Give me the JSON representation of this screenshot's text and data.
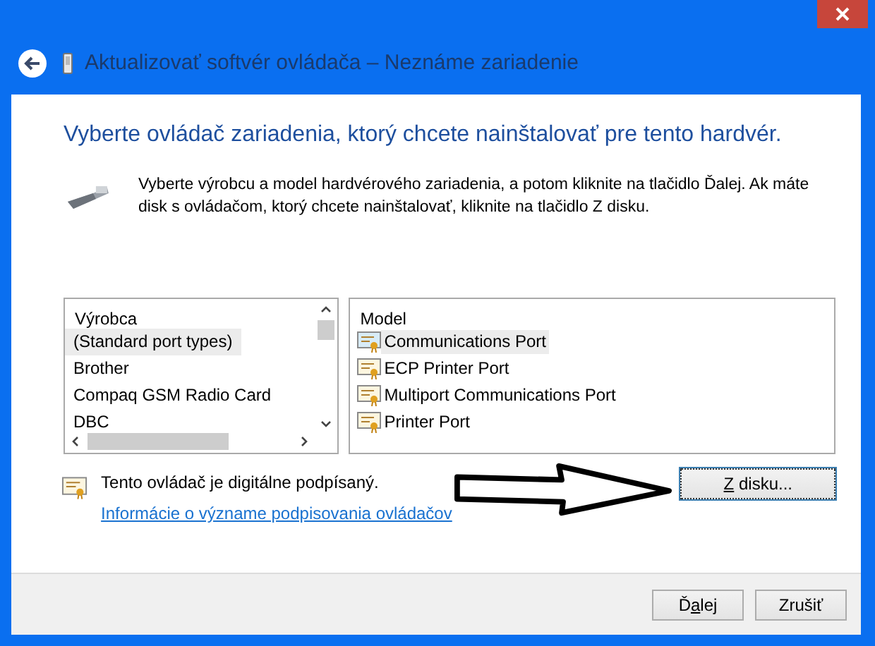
{
  "window": {
    "title": "Aktualizovať softvér ovládača – Neznáme zariadenie"
  },
  "heading": "Vyberte ovládač zariadenia, ktorý chcete nainštalovať pre tento hardvér.",
  "description": "Vyberte výrobcu a model hardvérového zariadenia, a potom kliknite na tlačidlo Ďalej. Ak máte disk s ovládačom, ktorý chcete nainštalovať, kliknite na tlačidlo Z disku.",
  "manufacturers": {
    "header": "Výrobca",
    "items": [
      {
        "label": "(Standard port types)",
        "selected": true
      },
      {
        "label": "Brother",
        "selected": false
      },
      {
        "label": "Compaq GSM Radio Card",
        "selected": false
      },
      {
        "label": "DBC",
        "selected": false
      }
    ]
  },
  "models": {
    "header": "Model",
    "items": [
      {
        "label": "Communications Port",
        "selected": true
      },
      {
        "label": "ECP Printer Port",
        "selected": false
      },
      {
        "label": "Multiport Communications Port",
        "selected": false
      },
      {
        "label": "Printer Port",
        "selected": false
      }
    ]
  },
  "signature": {
    "text": "Tento ovládač je digitálne podpísaný.",
    "link": "Informácie o význame podpisovania ovládačov"
  },
  "have_disk_button": {
    "key": "Z",
    "post": " disku..."
  },
  "footer_buttons": [
    {
      "pre": "Ď",
      "key": "a",
      "post": "lej"
    },
    {
      "pre": "Zrušiť"
    }
  ]
}
